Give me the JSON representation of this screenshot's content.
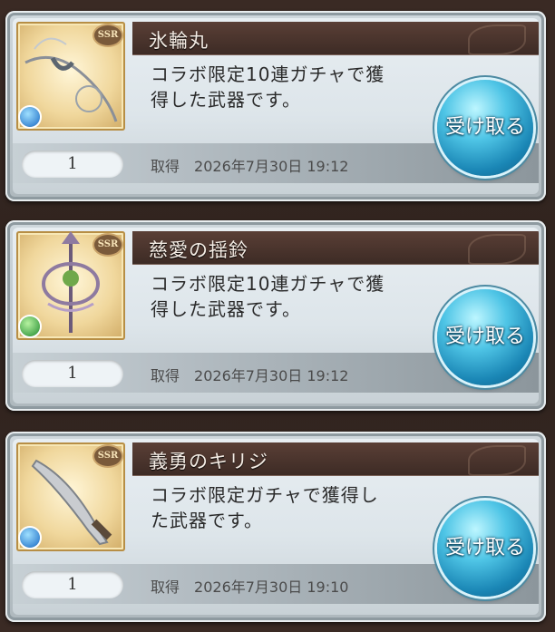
{
  "items": [
    {
      "name": "氷輪丸",
      "description": "コラボ限定10連ガチャで獲\n得した武器です。",
      "quantity": "1",
      "acquired_label": "取得",
      "acquired_date": "2026年7月30日 19:12",
      "rarity": "SSR",
      "element": "water-element-icon",
      "button_label": "受け取る"
    },
    {
      "name": "慈愛の揺鈴",
      "description": "コラボ限定10連ガチャで獲\n得した武器です。",
      "quantity": "1",
      "acquired_label": "取得",
      "acquired_date": "2026年7月30日 19:12",
      "rarity": "SSR",
      "element": "wind-element-icon",
      "button_label": "受け取る"
    },
    {
      "name": "義勇のキリジ",
      "description": "コラボ限定ガチャで獲得し\nた武器です。",
      "quantity": "1",
      "acquired_label": "取得",
      "acquired_date": "2026年7月30日 19:10",
      "rarity": "SSR",
      "element": "water-element-icon",
      "button_label": "受け取る"
    }
  ]
}
